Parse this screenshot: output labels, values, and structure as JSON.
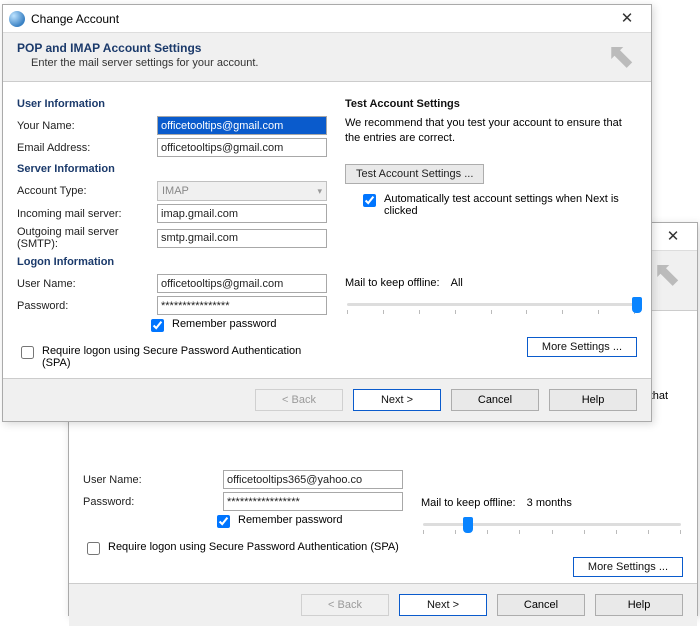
{
  "front": {
    "title": "Change Account",
    "header_h1": "POP and IMAP Account Settings",
    "header_h2": "Enter the mail server settings for your account.",
    "sect_user": "User Information",
    "your_name_label": "Your Name:",
    "your_name_value": "officetooltips@gmail.com",
    "email_label": "Email Address:",
    "email_value": "officetooltips@gmail.com",
    "sect_server": "Server Information",
    "account_type_label": "Account Type:",
    "account_type_value": "IMAP",
    "incoming_label": "Incoming mail server:",
    "incoming_value": "imap.gmail.com",
    "outgoing_label": "Outgoing mail server (SMTP):",
    "outgoing_value": "smtp.gmail.com",
    "sect_logon": "Logon Information",
    "username_label": "User Name:",
    "username_value": "officetooltips@gmail.com",
    "password_label": "Password:",
    "password_value": "****************",
    "remember_label": "Remember password",
    "spa_label": "Require logon using Secure Password Authentication (SPA)",
    "test_heading": "Test Account Settings",
    "test_desc": "We recommend that you test your account to ensure that the entries are correct.",
    "test_btn": "Test Account Settings ...",
    "auto_test_label": "Automatically test account settings when Next is clicked",
    "offline_label": "Mail to keep offline:",
    "offline_value": "All",
    "slider_pos_pct": 100,
    "more_settings": "More Settings ...",
    "btn_back": "< Back",
    "btn_next": "Next >",
    "btn_cancel": "Cancel",
    "btn_help": "Help"
  },
  "back": {
    "test_desc_fragment": "ensure that",
    "username_label": "User Name:",
    "username_value": "officetooltips365@yahoo.co",
    "password_label": "Password:",
    "password_value": "*****************",
    "remember_label": "Remember password",
    "spa_label": "Require logon using Secure Password Authentication (SPA)",
    "offline_label": "Mail to keep offline:",
    "offline_value": "3 months",
    "slider_pos_pct": 18,
    "more_settings": "More Settings ...",
    "btn_back": "< Back",
    "btn_next": "Next >",
    "btn_cancel": "Cancel",
    "btn_help": "Help"
  }
}
